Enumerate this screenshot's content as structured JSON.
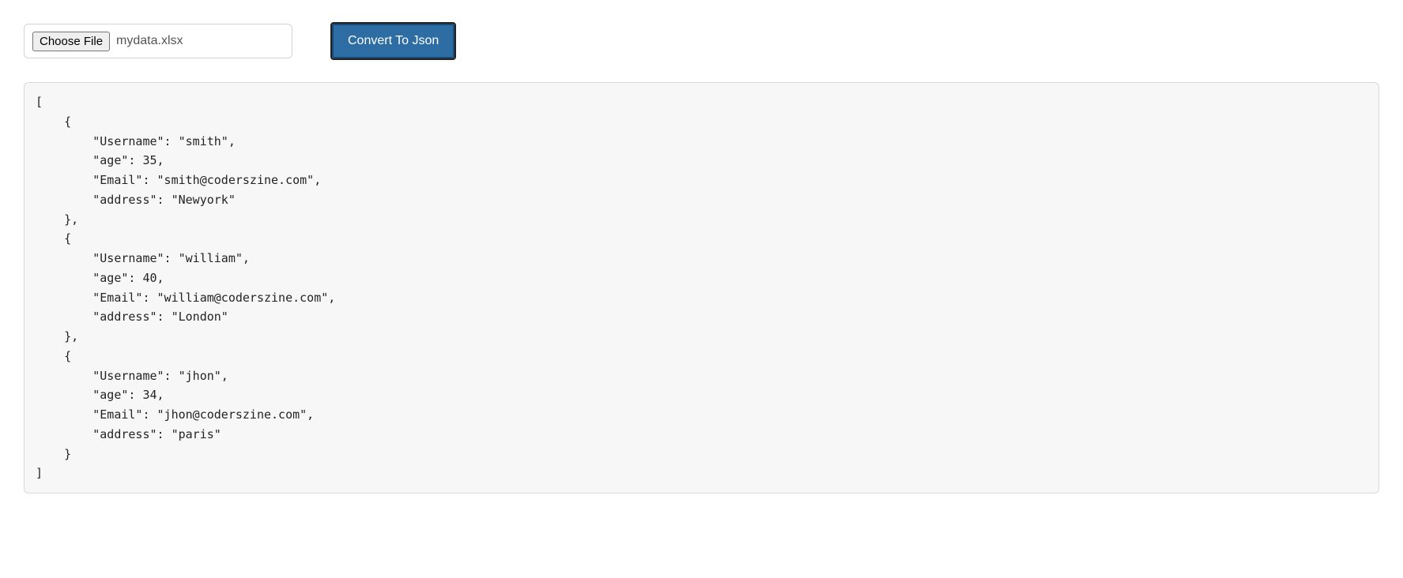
{
  "toolbar": {
    "choose_file_label": "Choose File",
    "filename": "mydata.xlsx",
    "convert_label": "Convert To Json"
  },
  "output": {
    "records": [
      {
        "Username": "smith",
        "age": 35,
        "Email": "smith@coderszine.com",
        "address": "Newyork"
      },
      {
        "Username": "william",
        "age": 40,
        "Email": "william@coderszine.com",
        "address": "London"
      },
      {
        "Username": "jhon",
        "age": 34,
        "Email": "jhon@coderszine.com",
        "address": "paris"
      }
    ]
  }
}
